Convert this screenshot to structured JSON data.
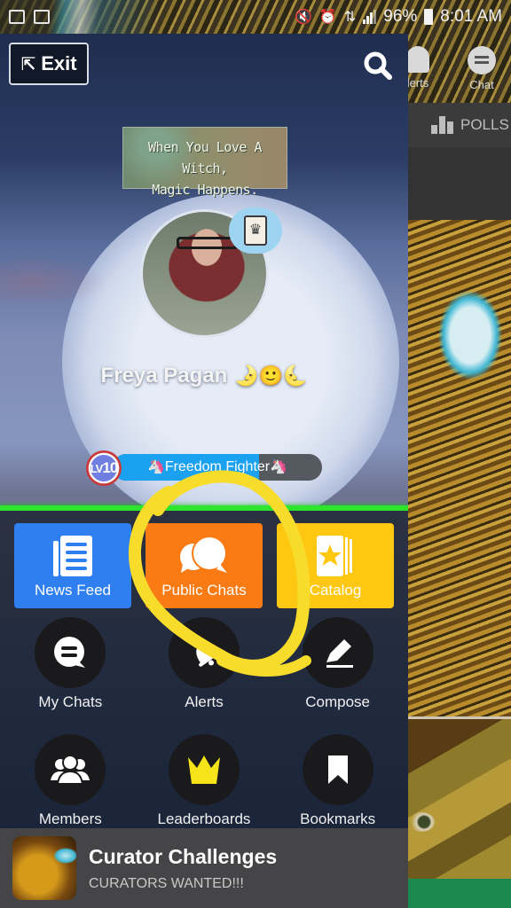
{
  "status_bar": {
    "left_icons": [
      "gallery-notification-icon",
      "gmail-notification-icon"
    ],
    "right_icons": [
      "mute-vibrate-icon",
      "alarm-icon",
      "data-icon",
      "signal-icon"
    ],
    "battery": "96%",
    "time": "8:01 AM"
  },
  "background_app": {
    "nav": [
      {
        "label": "lerts",
        "icon": "bell-icon"
      },
      {
        "label": "Chat",
        "icon": "chat-icon"
      }
    ],
    "tab": {
      "label": "POLLS",
      "icon": "bar-chart-icon"
    }
  },
  "drawer": {
    "exit_label": "Exit",
    "search_icon": "search-icon",
    "banner_lines": [
      "When You Love A Witch,",
      "Magic Happens."
    ],
    "user": {
      "name": "Freya Pagan",
      "name_emoji": "🌛🙂🌜",
      "level_prefix": "LV",
      "level": "10",
      "title": "🦄Freedom Fighter🦄",
      "level_progress": 0.7
    },
    "colors": {
      "news_feed": "#2f7ff0",
      "public_chats": "#fa7a14",
      "catalog": "#fdc712",
      "accent_line": "#2ee52e",
      "leaderboard_crown": "#f6e31a",
      "annotation": "#f7dc2c"
    },
    "tiles": [
      {
        "label": "News Feed",
        "icon": "newspaper-icon"
      },
      {
        "label": "Public Chats",
        "icon": "chat-bubbles-icon"
      },
      {
        "label": "Catalog",
        "icon": "catalog-star-icon"
      }
    ],
    "shortcuts": [
      {
        "label": "My Chats",
        "icon": "chat-icon"
      },
      {
        "label": "Alerts",
        "icon": "bell-icon"
      },
      {
        "label": "Compose",
        "icon": "pencil-icon"
      },
      {
        "label": "Members",
        "icon": "members-icon"
      },
      {
        "label": "Leaderboards",
        "icon": "crown-icon"
      },
      {
        "label": "Bookmarks",
        "icon": "bookmark-icon"
      }
    ],
    "promo": {
      "title": "Curator Challenges",
      "subtitle": "CURATORS WANTED!!!"
    }
  }
}
